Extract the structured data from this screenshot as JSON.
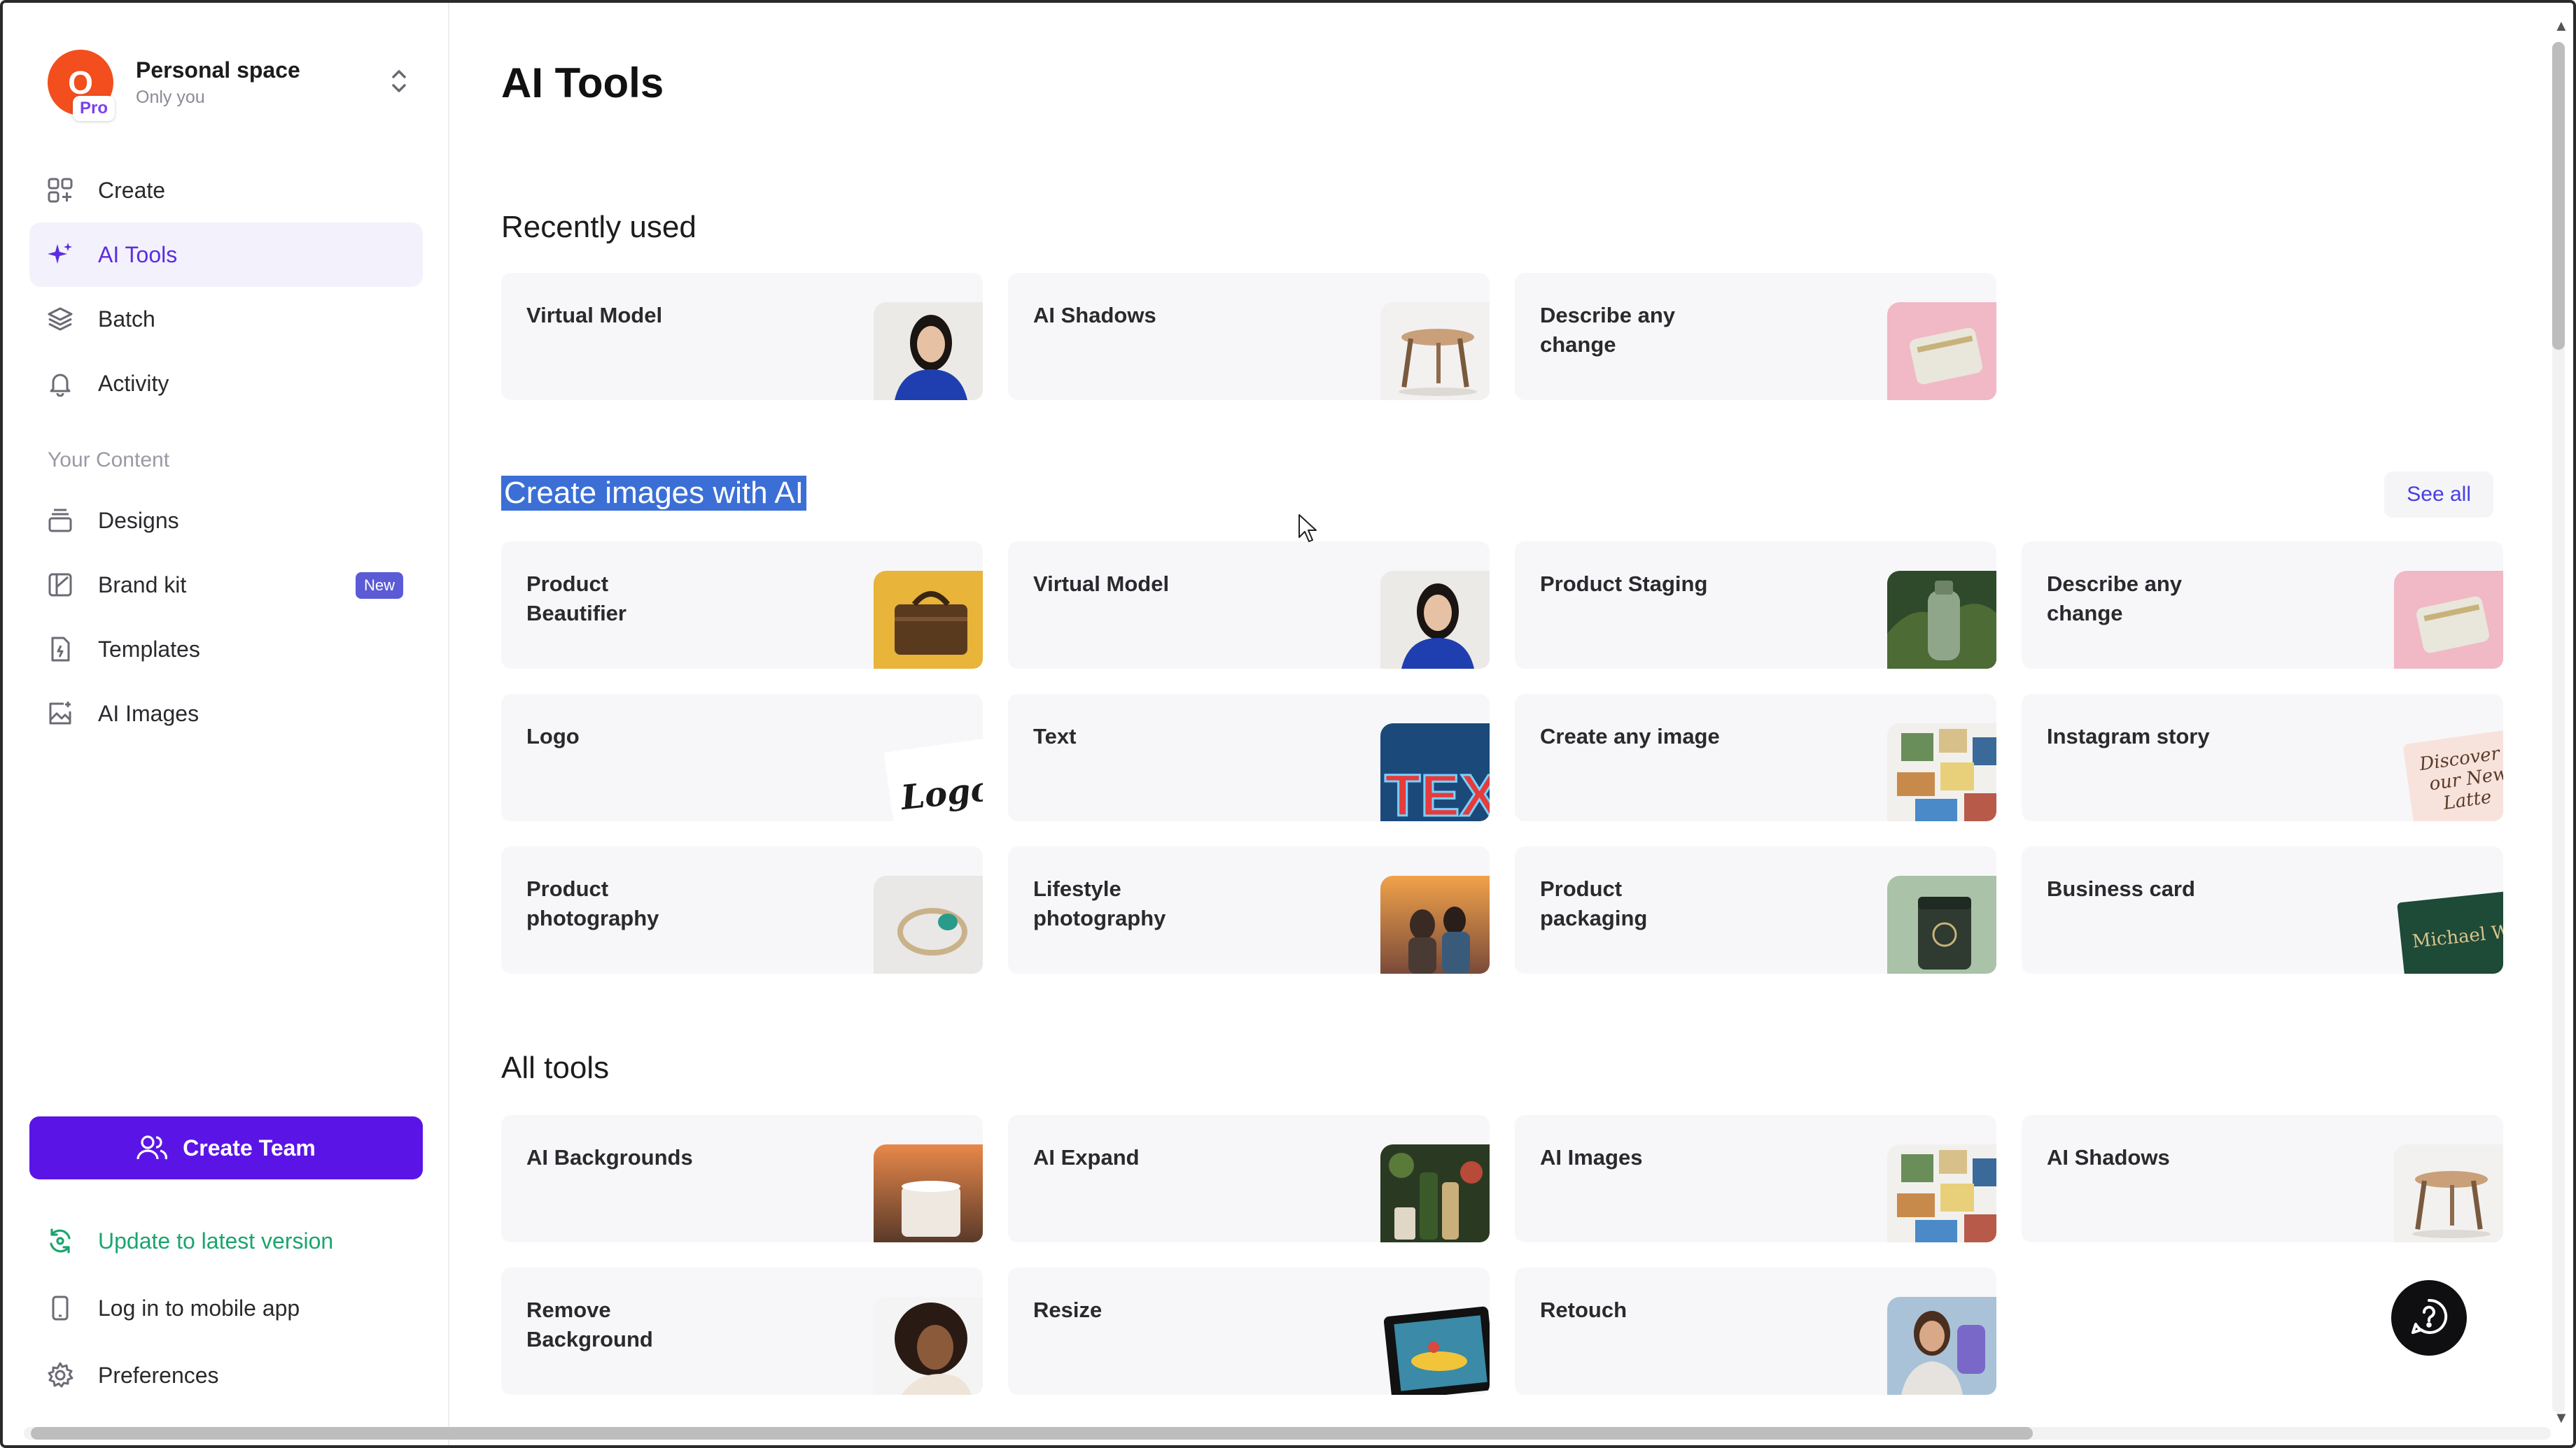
{
  "workspace": {
    "initial": "O",
    "name": "Personal space",
    "subtitle": "Only you",
    "badge": "Pro"
  },
  "sidebar": {
    "items": [
      {
        "label": "Create",
        "icon": "grid-plus-icon"
      },
      {
        "label": "AI Tools",
        "icon": "sparkle-icon",
        "active": true
      },
      {
        "label": "Batch",
        "icon": "layers-icon"
      },
      {
        "label": "Activity",
        "icon": "bell-icon"
      }
    ],
    "section_label": "Your Content",
    "content_items": [
      {
        "label": "Designs",
        "icon": "stack-icon"
      },
      {
        "label": "Brand kit",
        "icon": "brand-kit-icon",
        "badge": "New"
      },
      {
        "label": "Templates",
        "icon": "template-icon"
      },
      {
        "label": "AI Images",
        "icon": "ai-image-icon"
      }
    ],
    "create_team_label": "Create Team",
    "bottom_items": [
      {
        "label": "Update to latest version",
        "icon": "refresh-icon"
      },
      {
        "label": "Log in to mobile app",
        "icon": "phone-icon"
      },
      {
        "label": "Preferences",
        "icon": "gear-icon"
      }
    ]
  },
  "main": {
    "title": "AI Tools",
    "recently_used": {
      "title": "Recently used",
      "cards": [
        {
          "label": "Virtual Model",
          "thumb": "portrait"
        },
        {
          "label": "AI Shadows",
          "thumb": "table"
        },
        {
          "label": "Describe any\nchange",
          "thumb": "pouch"
        }
      ]
    },
    "create_images": {
      "title": "Create images with AI",
      "see_all": "See all",
      "cards": [
        {
          "label": "Product\nBeautifier",
          "thumb": "bag"
        },
        {
          "label": "Virtual Model",
          "thumb": "portrait"
        },
        {
          "label": "Product Staging",
          "thumb": "bottle"
        },
        {
          "label": "Describe any\nchange",
          "thumb": "pouch"
        },
        {
          "label": "Logo",
          "thumb": "logo"
        },
        {
          "label": "Text",
          "thumb": "text"
        },
        {
          "label": "Create any image",
          "thumb": "collage"
        },
        {
          "label": "Instagram story",
          "thumb": "latte"
        },
        {
          "label": "Product\nphotography",
          "thumb": "ring"
        },
        {
          "label": "Lifestyle\nphotography",
          "thumb": "sunset"
        },
        {
          "label": "Product\npackaging",
          "thumb": "jar"
        },
        {
          "label": "Business card",
          "thumb": "card"
        }
      ]
    },
    "all_tools": {
      "title": "All tools",
      "cards": [
        {
          "label": "AI Backgrounds",
          "thumb": "candle"
        },
        {
          "label": "AI Expand",
          "thumb": "bottles"
        },
        {
          "label": "AI Images",
          "thumb": "collage"
        },
        {
          "label": "AI Shadows",
          "thumb": "table"
        },
        {
          "label": "Remove\nBackground",
          "thumb": "curly"
        },
        {
          "label": "Resize",
          "thumb": "raft"
        },
        {
          "label": "Retouch",
          "thumb": "woman"
        }
      ]
    }
  },
  "thumb_text": {
    "logo": "Logos",
    "text": "TEX",
    "latte": "Discover\nour New\nLatte",
    "card": "Michael Won"
  },
  "colors": {
    "accent": "#5b14e6",
    "avatar": "#f24e1e",
    "update": "#1aa56e",
    "highlight": "#3b6fd6"
  }
}
